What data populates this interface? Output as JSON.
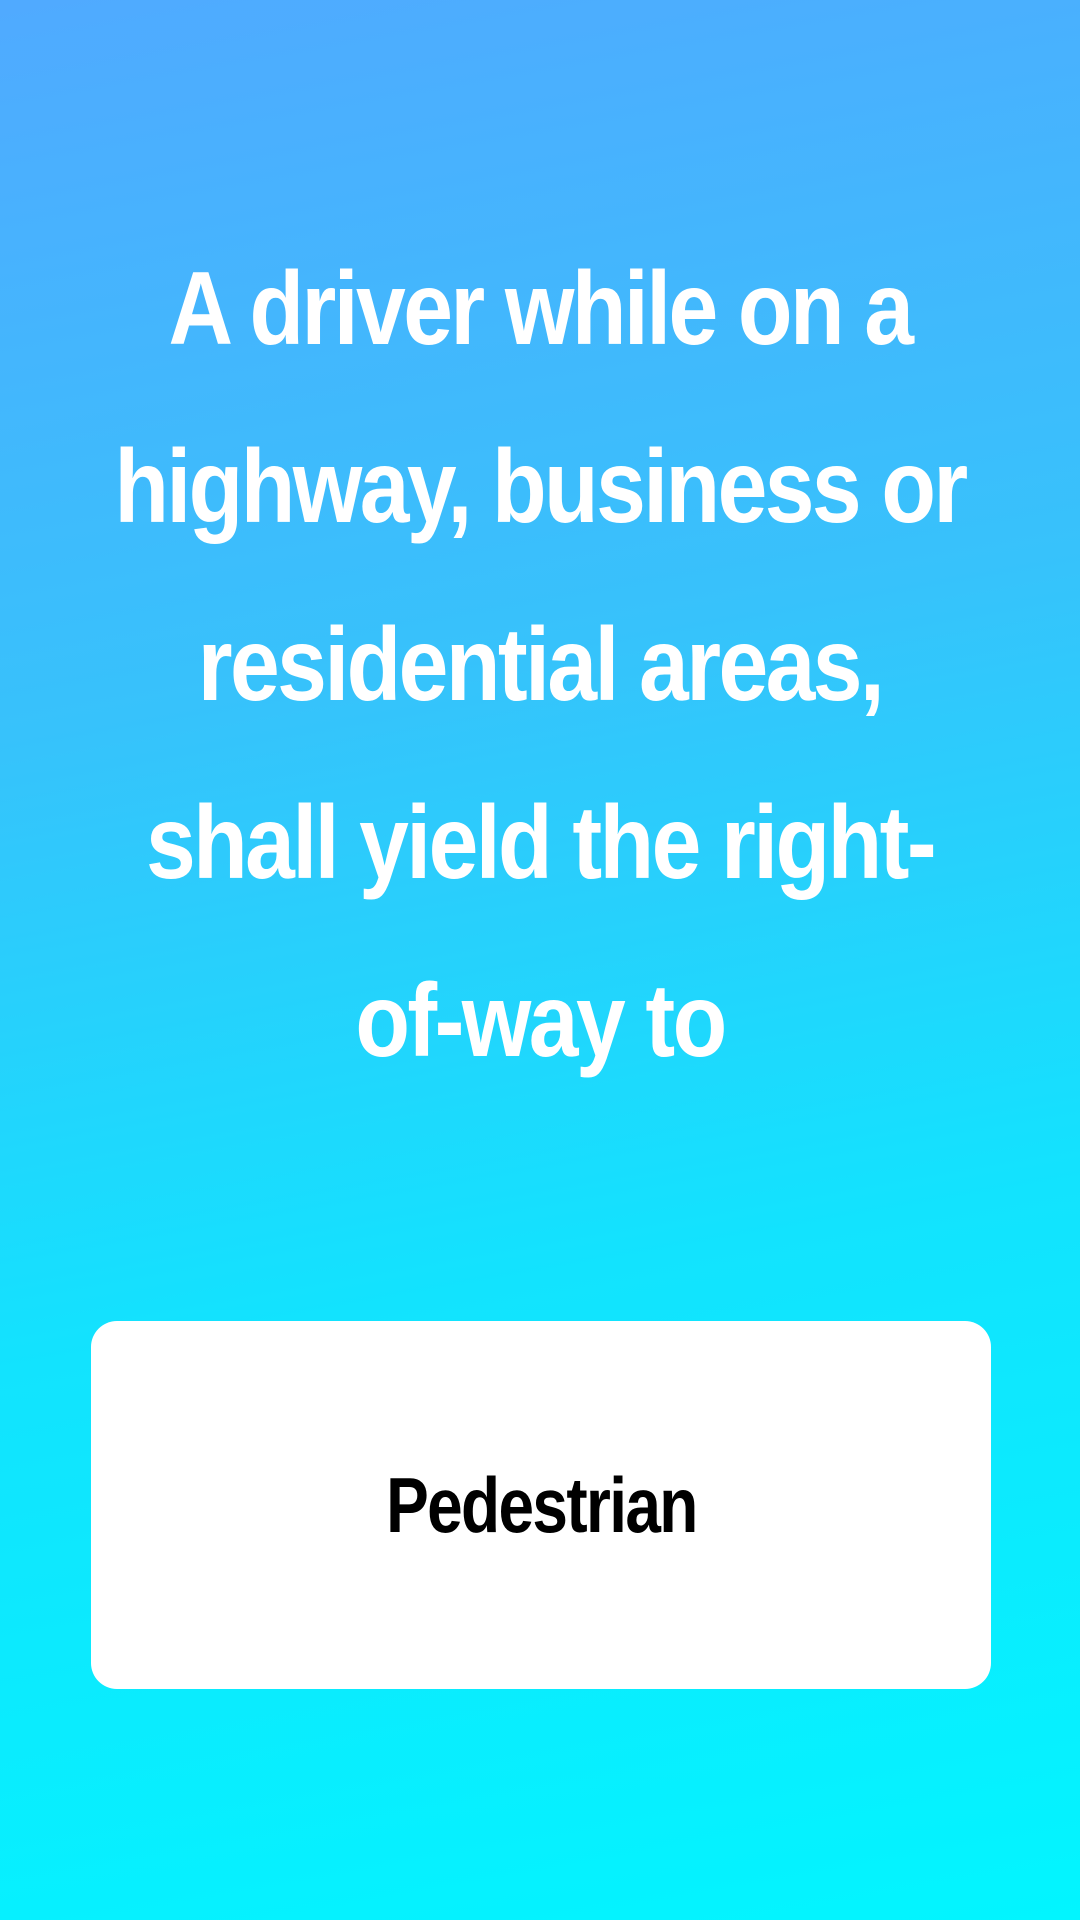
{
  "question": {
    "text": "A driver while on a highway, business or residential areas, shall yield the right-of-way to"
  },
  "answer": {
    "label": "Pedestrian"
  },
  "colors": {
    "gradient_top": "#50aaff",
    "gradient_bottom": "#02f5ff",
    "question_text": "#ffffff",
    "card_background": "#ffffff",
    "card_text": "#000000"
  }
}
